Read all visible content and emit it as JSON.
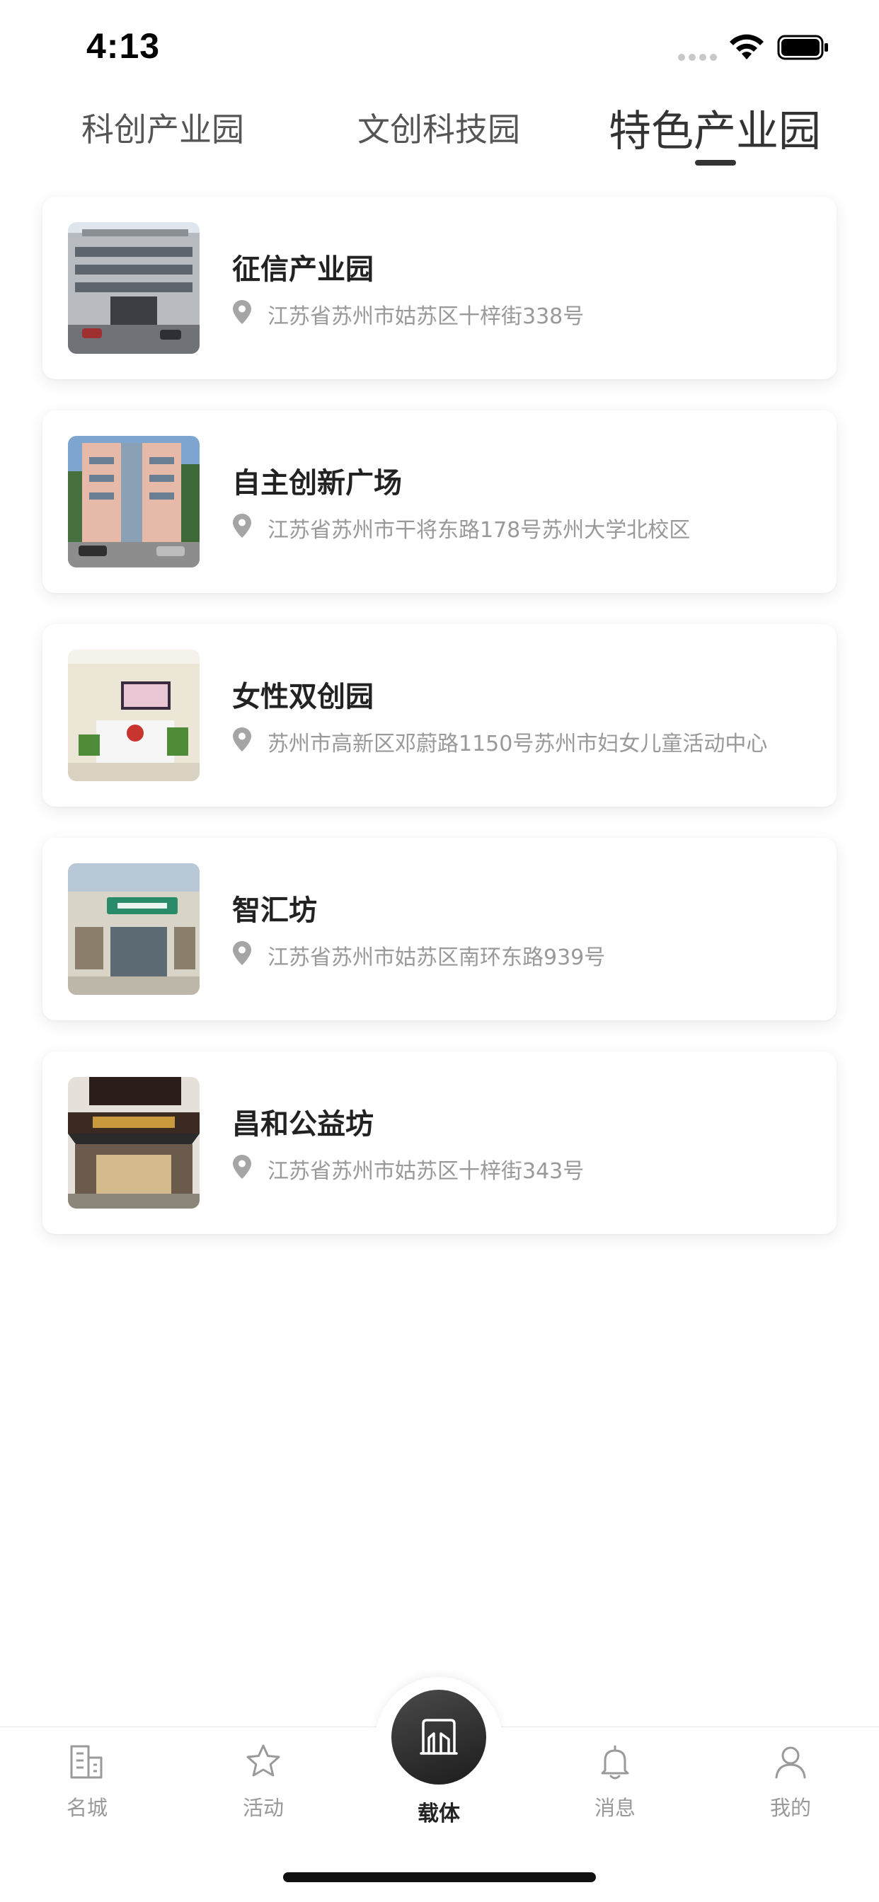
{
  "status_bar": {
    "time": "4:13"
  },
  "tabs": [
    {
      "label": "科创产业园"
    },
    {
      "label": "文创科技园"
    },
    {
      "label": "特色产业园"
    }
  ],
  "active_tab": "特色产业园",
  "parks": [
    {
      "name": "征信产业园",
      "address": "江苏省苏州市姑苏区十梓街338号"
    },
    {
      "name": "自主创新广场",
      "address": "江苏省苏州市干将东路178号苏州大学北校区"
    },
    {
      "name": "女性双创园",
      "address": "苏州市高新区邓蔚路1150号苏州市妇女儿童活动中心"
    },
    {
      "name": "智汇坊",
      "address": "江苏省苏州市姑苏区南环东路939号"
    },
    {
      "name": "昌和公益坊",
      "address": "江苏省苏州市姑苏区十梓街343号"
    }
  ],
  "bottom_nav": {
    "items": [
      {
        "label": "名城",
        "icon": "city-building-icon"
      },
      {
        "label": "活动",
        "icon": "star-icon"
      },
      {
        "label": "载体",
        "icon": "carrier-building-icon"
      },
      {
        "label": "消息",
        "icon": "bell-icon"
      },
      {
        "label": "我的",
        "icon": "user-icon"
      }
    ],
    "active": "载体"
  },
  "colors": {
    "active_text": "#222222",
    "inactive_text": "#999999",
    "center_button": "#2a2a2a"
  }
}
